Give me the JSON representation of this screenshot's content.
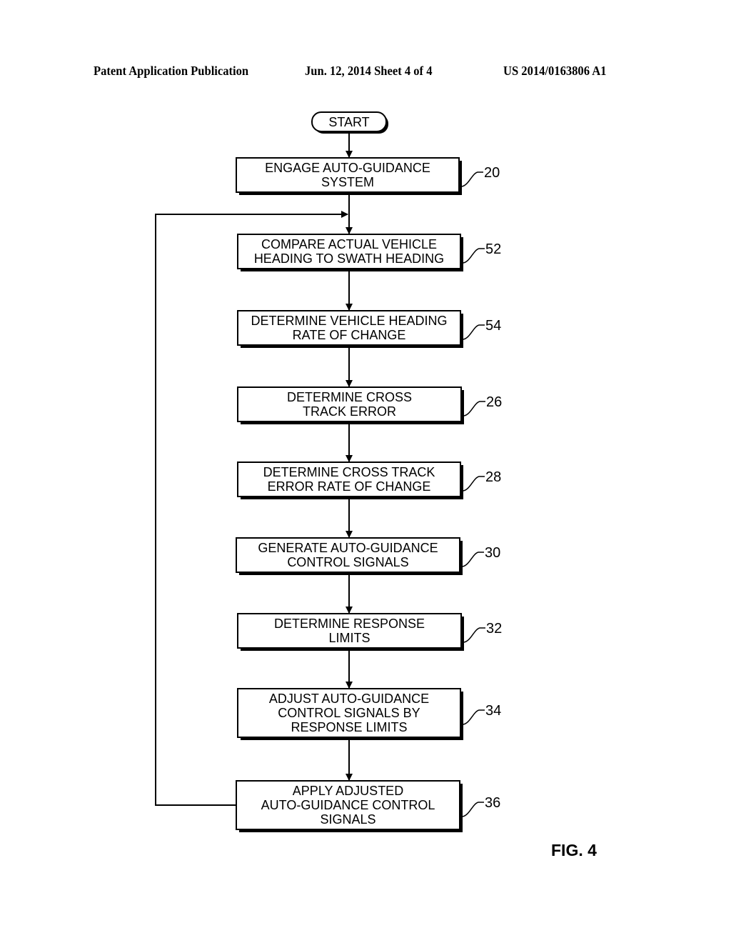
{
  "header": {
    "left": "Patent Application Publication",
    "center": "Jun. 12, 2014  Sheet 4 of 4",
    "right": "US 2014/0163806 A1"
  },
  "flowchart": {
    "start_label": "START",
    "steps": [
      {
        "ref": "20",
        "lines": [
          "ENGAGE AUTO-GUIDANCE",
          "SYSTEM"
        ]
      },
      {
        "ref": "52",
        "lines": [
          "COMPARE ACTUAL VEHICLE",
          "HEADING TO SWATH HEADING"
        ]
      },
      {
        "ref": "54",
        "lines": [
          "DETERMINE VEHICLE HEADING",
          "RATE OF CHANGE"
        ]
      },
      {
        "ref": "26",
        "lines": [
          "DETERMINE CROSS",
          "TRACK ERROR"
        ]
      },
      {
        "ref": "28",
        "lines": [
          "DETERMINE CROSS TRACK",
          "ERROR RATE OF CHANGE"
        ]
      },
      {
        "ref": "30",
        "lines": [
          "GENERATE AUTO-GUIDANCE",
          "CONTROL SIGNALS"
        ]
      },
      {
        "ref": "32",
        "lines": [
          "DETERMINE RESPONSE",
          "LIMITS"
        ]
      },
      {
        "ref": "34",
        "lines": [
          "ADJUST AUTO-GUIDANCE",
          "CONTROL SIGNALS BY",
          "RESPONSE LIMITS"
        ]
      },
      {
        "ref": "36",
        "lines": [
          "APPLY ADJUSTED",
          "AUTO-GUIDANCE CONTROL",
          "SIGNALS"
        ]
      }
    ],
    "loop": {
      "from_step": "36",
      "to_step": "52"
    }
  },
  "figure_label": "FIG. 4"
}
